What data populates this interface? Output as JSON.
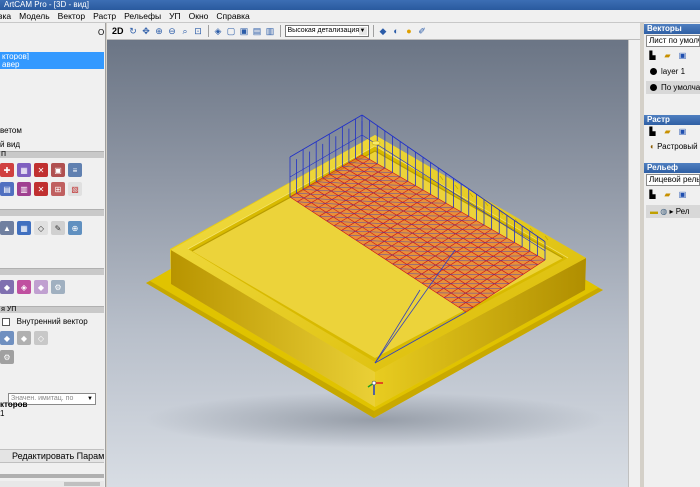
{
  "window": {
    "title": "ArtCAM Pro - [3D - вид]"
  },
  "menu": [
    "вка",
    "Модель",
    "Вектор",
    "Растр",
    "Рельефы",
    "УП",
    "Окно",
    "Справка"
  ],
  "left_panel": {
    "corner_letter": "О",
    "selected_line_1": "кторов]",
    "selected_line_2": "авер",
    "text_1": "ветом",
    "text_2": "й вид",
    "group_1": "П",
    "group_4": "я УП",
    "inner_vector_label": "Внутренний вектор",
    "combo_placeholder": "Значен. имитац. по",
    "vectors_label": "кторов",
    "digit": "1",
    "edit_params_button": "Редактировать Параме"
  },
  "toolbar": {
    "mode_2d": "2D",
    "detail_select": "Высокая детализация"
  },
  "right_panel": {
    "vectors": {
      "header": "Векторы",
      "sheet_field": "Лист по умолча",
      "layer_1": "layer 1",
      "default_layer": "По умолча"
    },
    "raster": {
      "header": "Растр",
      "item": "Растровый"
    },
    "relief": {
      "header": "Рельеф",
      "field": "Лицевой рельеф",
      "item": "Рел"
    }
  },
  "colors": {
    "plate": "#e5c700",
    "grid_blue": "#2030c8",
    "grid_red": "#e02020",
    "panel_header": "#3a6ab0"
  }
}
